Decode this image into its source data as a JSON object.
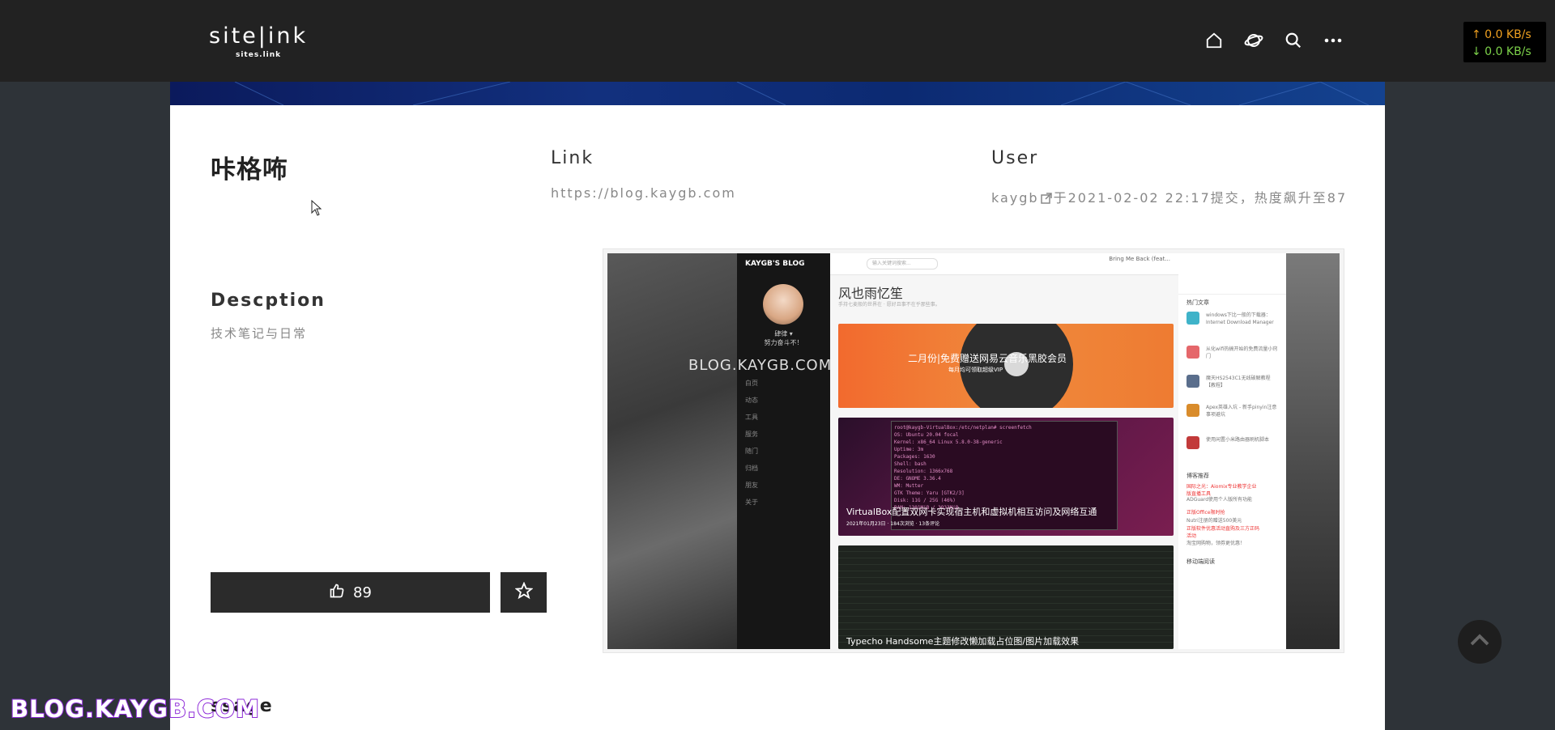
{
  "navbar": {
    "logo_main": "site|ink",
    "logo_sub": "sites.link",
    "icons": [
      "home-icon",
      "planet-icon",
      "search-icon",
      "more-icon"
    ],
    "net_up": "↑ 0.0 KB/s",
    "net_down": "↓ 0.0 KB/s"
  },
  "site": {
    "name": "咔格咘",
    "link_heading": "Link",
    "link_url": "https://blog.kaygb.com",
    "user_heading": "User",
    "user_name": "kaygb",
    "user_info": "于2021-02-02 22:17提交，热度飙升至87",
    "desc_heading": "Descption",
    "desc_text": "技术笔记与日常",
    "likes": "89",
    "message_heading": "ssage"
  },
  "preview": {
    "blog_title": "KAYGB'S BLOG",
    "user_name": "肆律 ▾",
    "user_motto": "努力奋斗不！",
    "menu": [
      "白页",
      "动态",
      "工具",
      "服务",
      "随门",
      "归档",
      "朋友",
      "关于",
      "关于"
    ],
    "search_placeholder": "输入关键词搜索...",
    "music": "Bring Me Back (feat...",
    "heading": "风也雨忆笙",
    "subheading": "手持七麦般的世界在 · 愿好且事不在乎那些事。",
    "watermark": "BLOG.KAYGB.COM",
    "post1_title": "二月份|免费赠送网易云音乐黑胶会员",
    "post1_sub": "每月均可领取超级VIP",
    "post2_title": "VirtualBox配置双网卡实现宿主机和虚拟机相互访问及网络互通",
    "post2_meta": "2021年01月23日 · 184次浏览 · 13条评论",
    "post3_title": "Typecho Handsome主题修改懒加载占位图/图片加载效果",
    "right_hot": "热门文章",
    "right_items": [
      "windows下比一般的下载器：Internet Download Manager",
      "从化wifi热搞开始的免费流量小窍门",
      "魔天HS2543C1无线破解教程【教程】",
      "Apex英雄入坑 - 新手pinyin注意事项避坑",
      "使用闲置小米路由器刷机脚本"
    ],
    "right_recommend": "博客推荐",
    "right_notes": [
      "国际之光：Aiomix专业教学企业版直播工具",
      "ADGuard使用个人版所有功能",
      "正版Office限时抢",
      "Nutri注册的赠送500美元",
      "正版软件优惠活动直购及三方正码活动",
      "淘宝网购物，领券更优惠！"
    ],
    "right_mobile": "移动端阅读",
    "terminal_lines": [
      "root@kaygb-VirtualBox:/etc/netplan# screenfetch",
      "OS: Ubuntu 20.04 focal",
      "Kernel: x86_64 Linux 5.8.0-38-generic",
      "Uptime: 3m",
      "Packages: 1630",
      "Shell: bash",
      "Resolution: 1366x768",
      "DE: GNOME 3.36.4",
      "WM: Mutter",
      "GTK Theme: Yaru [GTK2/3]",
      "Disk: 11G / 25G (46%)",
      "RAM: 1301MiB / 3933MiB"
    ]
  },
  "footer": {
    "watermark": "BLOG.KAYGB.COM"
  },
  "colors": {
    "navbar": "#222222",
    "page_bg": "#2e3338",
    "button": "#2b2b2b",
    "net_up": "#f0a020",
    "net_down": "#7dd34a",
    "watermark_stroke": "#8e2bd8"
  }
}
